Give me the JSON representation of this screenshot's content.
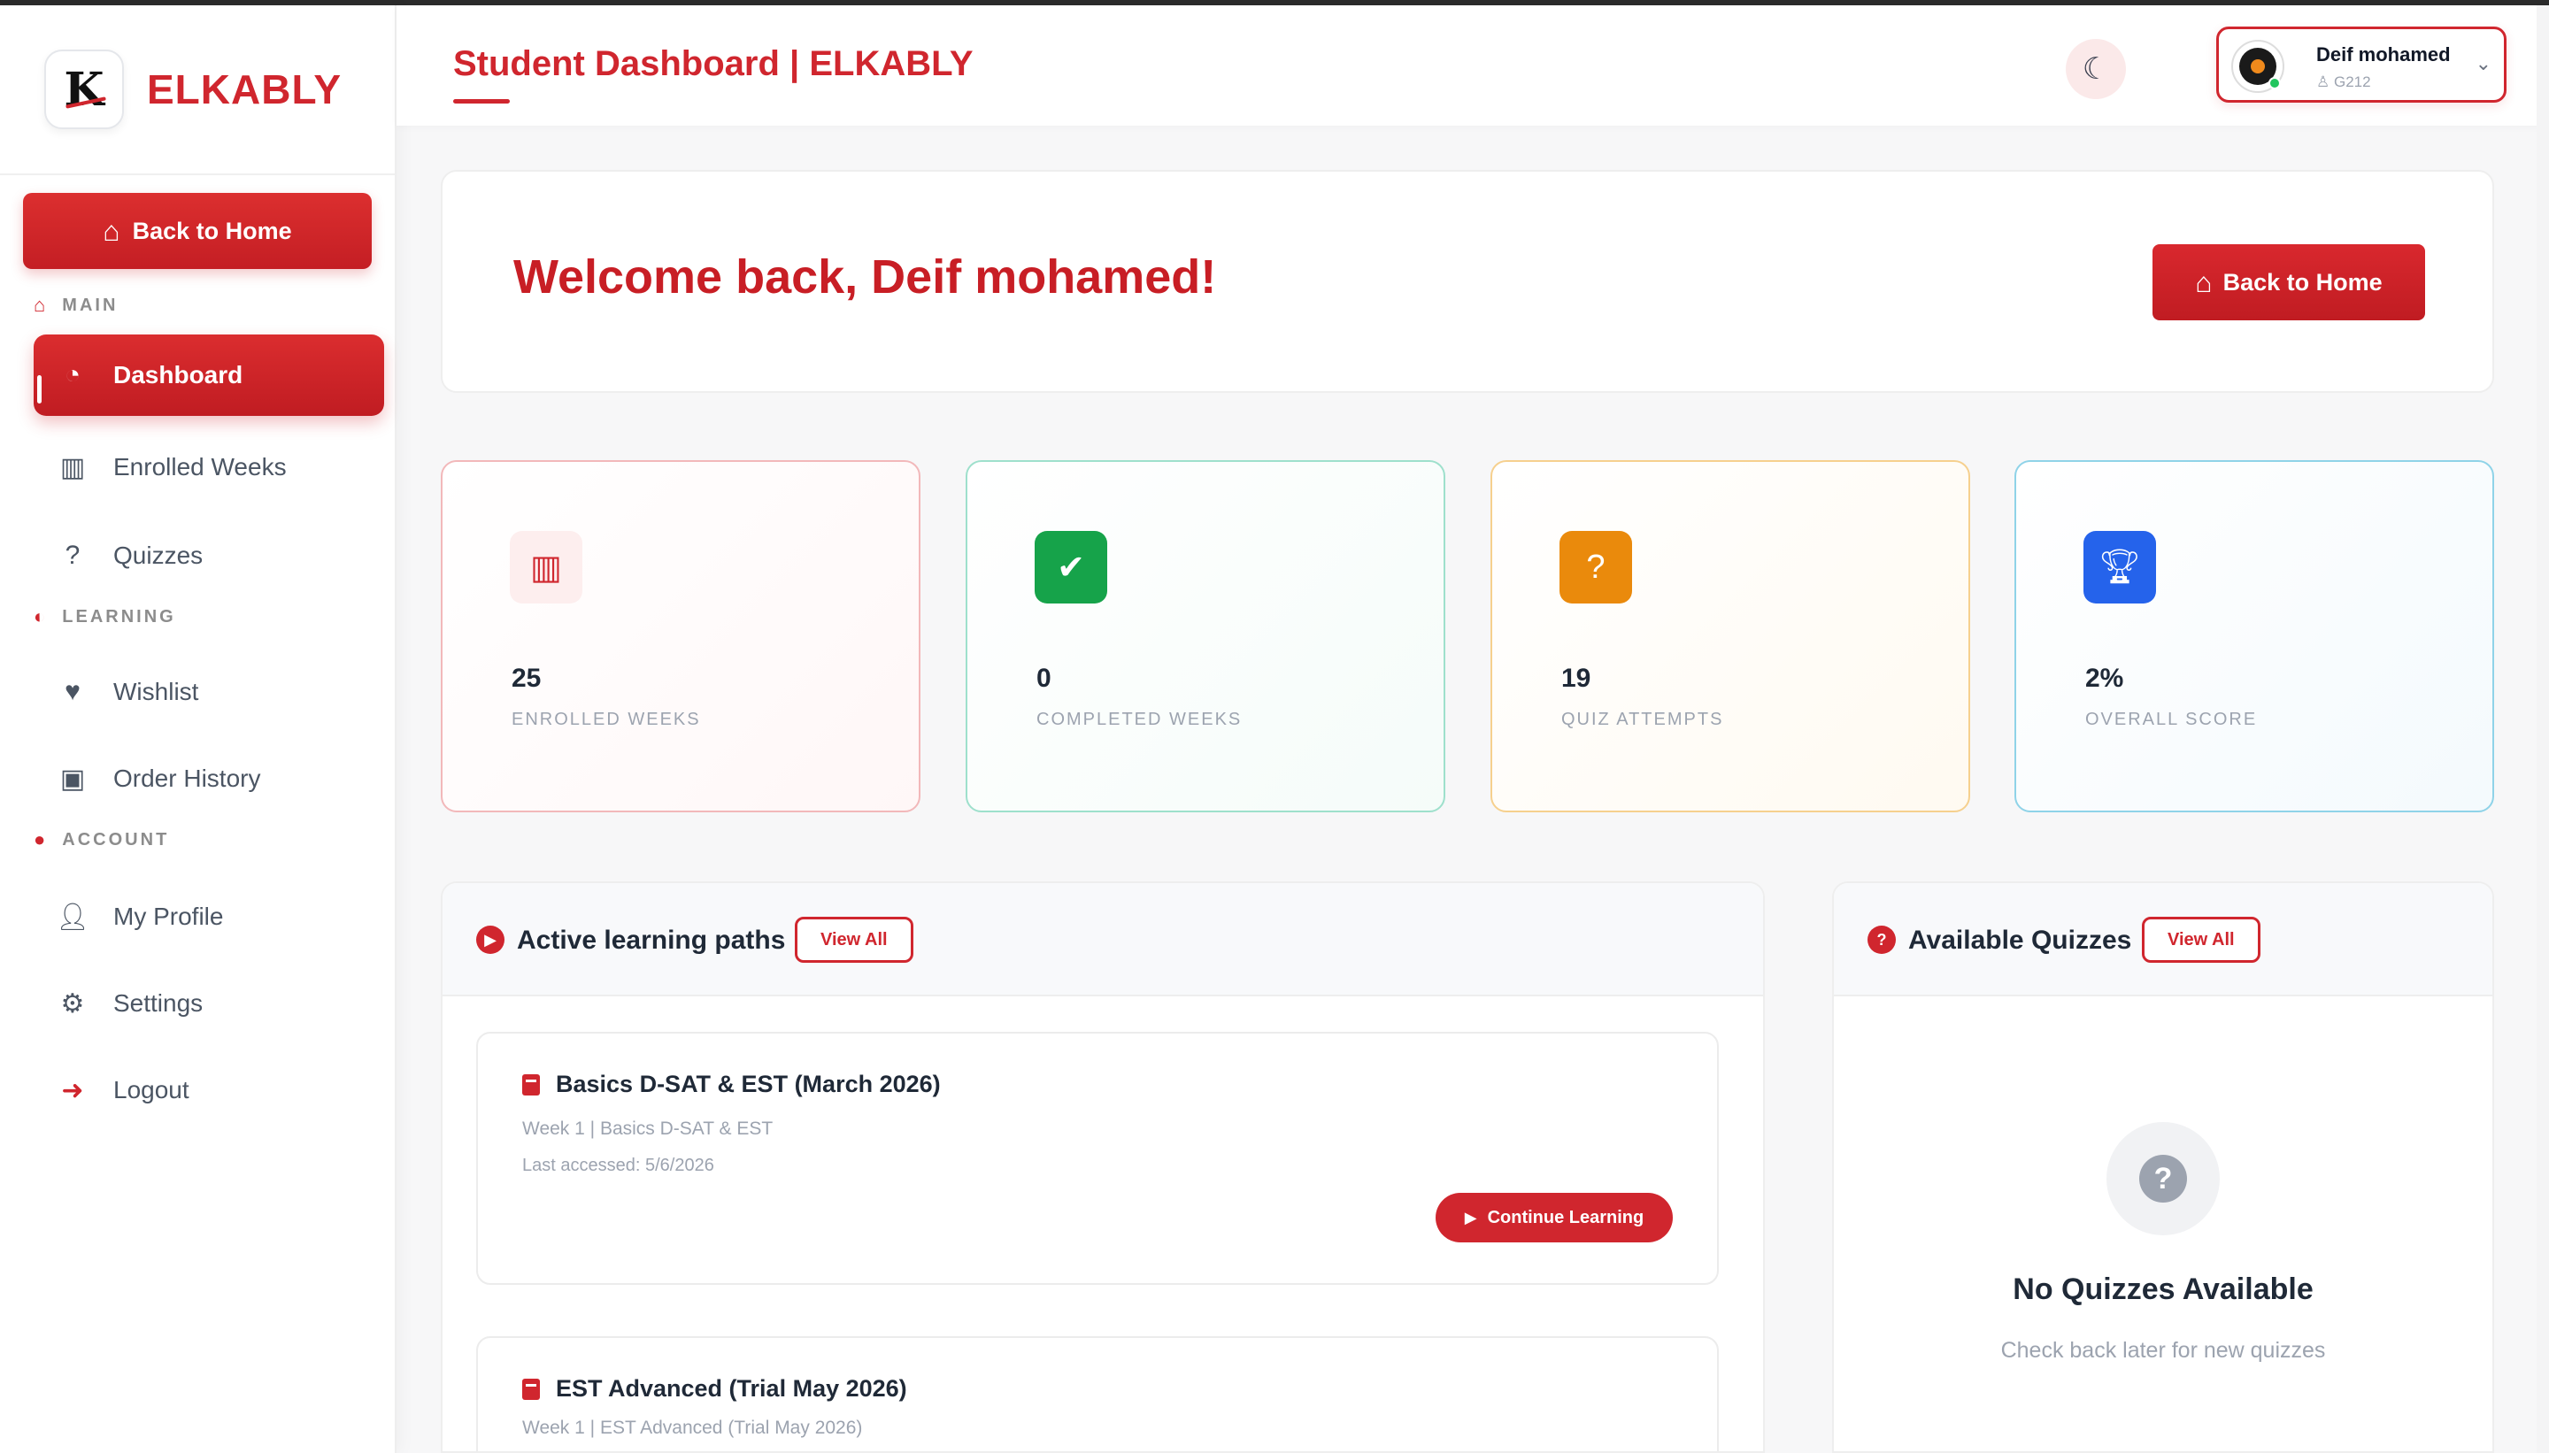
{
  "brand": {
    "name": "ELKABLY",
    "logo_letter": "K"
  },
  "header": {
    "title": "Student Dashboard | ELKABLY",
    "theme_icon": "moon-icon",
    "user": {
      "name": "Deif mohamed",
      "code": "G212"
    }
  },
  "sidebar": {
    "home_button": "Back to Home",
    "sections": {
      "main": "MAIN",
      "learning": "LEARNING",
      "account": "ACCOUNT"
    },
    "items": [
      {
        "label": "Dashboard",
        "icon": "dashboard-icon",
        "active": true
      },
      {
        "label": "Enrolled Weeks",
        "icon": "book-icon"
      },
      {
        "label": "Quizzes",
        "icon": "question-icon"
      },
      {
        "label": "Wishlist",
        "icon": "heart-icon"
      },
      {
        "label": "Order History",
        "icon": "bag-icon"
      },
      {
        "label": "My Profile",
        "icon": "user-icon"
      },
      {
        "label": "Settings",
        "icon": "gear-icon"
      },
      {
        "label": "Logout",
        "icon": "logout-icon"
      }
    ]
  },
  "welcome": {
    "text": "Welcome back, Deif mohamed!",
    "button": "Back to Home"
  },
  "stats": [
    {
      "value": "25",
      "label": "ENROLLED WEEKS",
      "color": "#d0262e"
    },
    {
      "value": "0",
      "label": "COMPLETED WEEKS",
      "color": "#16a34a"
    },
    {
      "value": "19",
      "label": "QUIZ ATTEMPTS",
      "color": "#ea8a0c"
    },
    {
      "value": "2%",
      "label": "OVERALL SCORE",
      "color": "#2563eb"
    }
  ],
  "learning_paths": {
    "title": "Active learning paths",
    "view_all": "View All",
    "courses": [
      {
        "title": "Basics D-SAT & EST (March 2026)",
        "subtitle": "Week 1 | Basics D-SAT & EST",
        "last_accessed": "Last accessed: 5/6/2026",
        "button": "Continue Learning"
      },
      {
        "title": "EST Advanced (Trial May 2026)",
        "subtitle": "Week 1 | EST Advanced (Trial May 2026)"
      }
    ]
  },
  "quizzes": {
    "title": "Available Quizzes",
    "view_all": "View All",
    "empty_title": "No Quizzes Available",
    "empty_sub": "Check back later for new quizzes"
  },
  "colors": {
    "accent": "#d0262e"
  }
}
